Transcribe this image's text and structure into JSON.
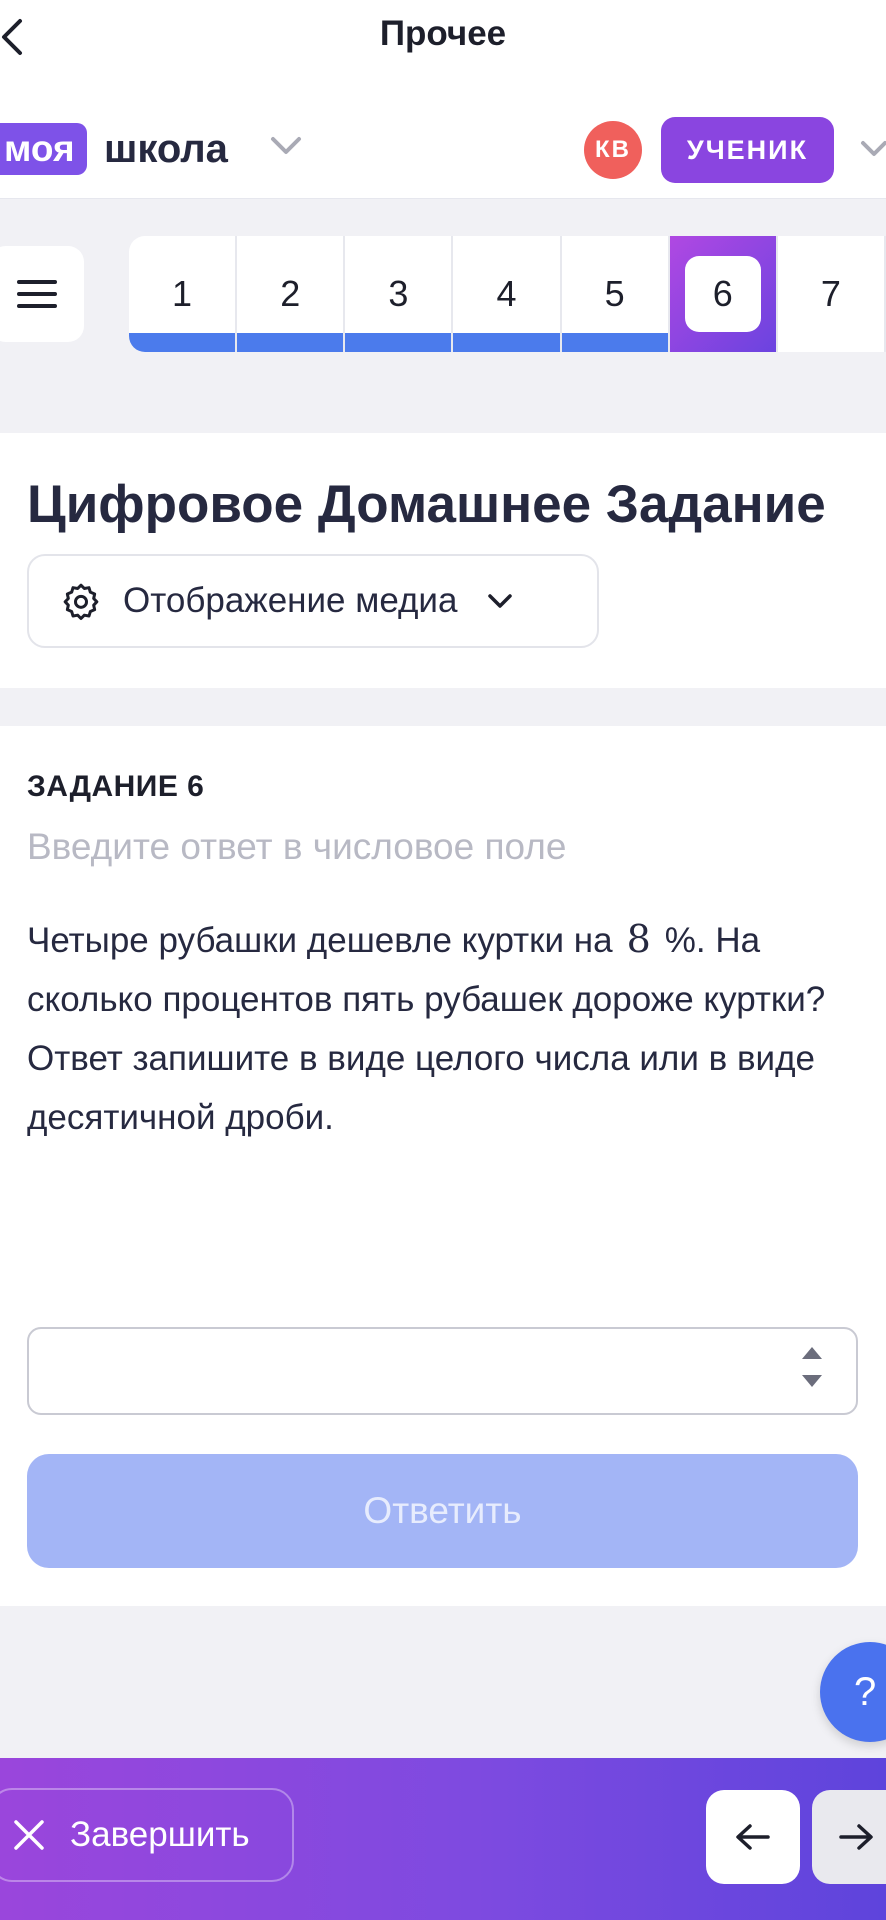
{
  "topbar": {
    "title": "Прочее",
    "back_icon": "chevron-left-icon"
  },
  "header": {
    "logo_highlight": "моя",
    "logo_word": "школа",
    "avatar_initials": "КВ",
    "role_label": "УЧЕНИК"
  },
  "tabs": [
    {
      "label": "1",
      "state": "done"
    },
    {
      "label": "2",
      "state": "done"
    },
    {
      "label": "3",
      "state": "done"
    },
    {
      "label": "4",
      "state": "done"
    },
    {
      "label": "5",
      "state": "done"
    },
    {
      "label": "6",
      "state": "active"
    },
    {
      "label": "7",
      "state": "pending"
    }
  ],
  "card": {
    "title": "Цифровое Домашнее Задание",
    "media_button_label": "Отображение медиа"
  },
  "task": {
    "label": "ЗАДАНИЕ 6",
    "hint": "Введите ответ в числовое поле",
    "question_part1": "Четыре рубашки дешевле куртки на",
    "question_math": "8",
    "question_part2": "%. На сколько процентов пять рубашек дороже куртки?  Ответ запишите в виде целого числа или в виде десятичной дроби.",
    "answer_value": "",
    "submit_label": "Ответить"
  },
  "help": {
    "label": "?"
  },
  "footer": {
    "finish_label": "Завершить"
  },
  "colors": {
    "accent_purple": "#8a45e0",
    "progress_blue": "#4b7bec",
    "submit_disabled": "#a3b5f6",
    "avatar_red": "#f0605c"
  }
}
